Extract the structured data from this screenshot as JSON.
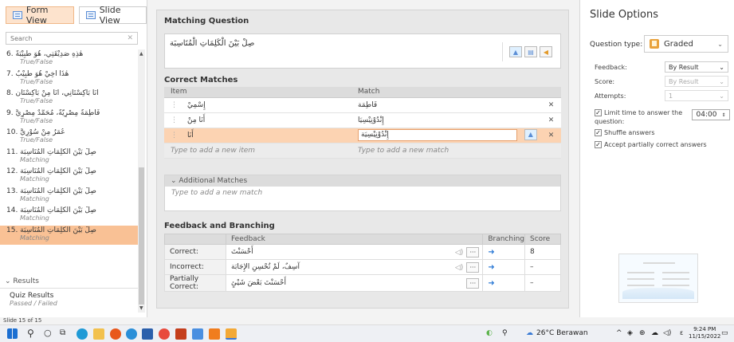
{
  "left_panel": {
    "form_view_label": "Form View",
    "slide_view_label": "Slide View",
    "search_placeholder": "Search",
    "slides": [
      {
        "title": "هٰذِهِ صَدِيْقَتِي، هُوَ طَبِيْبَةٌ .6",
        "subtitle": "True/False"
      },
      {
        "title": "هٰذَا أَخِيْ هُوَ طَبِيْبٌ .7",
        "subtitle": "True/False"
      },
      {
        "title": "أَنَا بَاكِسْتَانِي، أَنَا مِنْ بَاكِسْتَان .8",
        "subtitle": "True/False"
      },
      {
        "title": "فَاطِمَةٌ مِصْرِيَّةٌ، مُحَمَّدٌ مِصْرِيٌّ .9",
        "subtitle": "True/False"
      },
      {
        "title": "عُمَرُ مِنْ سُوْرِيَّ .10",
        "subtitle": "True/False"
      },
      {
        "title": "صِلْ بَيْنَ الْكَلِمَاتِ الْمُتَاسِبَة .11",
        "subtitle": "Matching"
      },
      {
        "title": "صِلْ بَيْنَ الْكَلِمَاتِ الْمُتَاسِبَة .12",
        "subtitle": "Matching"
      },
      {
        "title": "صِلْ بَيْنَ الْكَلِمَاتِ الْمُتَاسِبَة .13",
        "subtitle": "Matching"
      },
      {
        "title": "صِلْ بَيْنَ الْكَلِمَاتِ الْمُتَاسِبَة .14",
        "subtitle": "Matching"
      },
      {
        "title": "صِلْ بَيْنَ الْكَلِمَاتِ الْمُتَاسِبَة .15",
        "subtitle": "Matching"
      }
    ],
    "results_label": "Results",
    "quiz_results_title": "Quiz Results",
    "quiz_results_subtitle": "Passed / Failed"
  },
  "status": {
    "slide_counter": "Slide 15 of 15"
  },
  "matching": {
    "section_title": "Matching Question",
    "question_text": "صِلْ بَيْنَ الْكَلِمَاتِ الْمُتَاسِبَة",
    "correct_matches_title": "Correct Matches",
    "col_item": "Item",
    "col_match": "Match",
    "rows": [
      {
        "item": "إِسْمِيْ",
        "match": "فَاطِمَة"
      },
      {
        "item": "أَنَا مِنْ",
        "match": "إِنْدُوْنِيْسِيَا"
      },
      {
        "item": "أَنَا",
        "match": "إِنْدُوْنِيْسِيَة"
      }
    ],
    "add_item_placeholder": "Type to add a new item",
    "add_match_placeholder": "Type to add a new match",
    "additional_matches_label": "Additional Matches",
    "additional_match_placeholder": "Type to add a new match"
  },
  "feedback": {
    "section_title": "Feedback and Branching",
    "col_feedback": "Feedback",
    "col_branching": "Branching",
    "col_score": "Score",
    "rows": [
      {
        "label": "Correct:",
        "text": "أَحْسَنْتَ",
        "score": "8"
      },
      {
        "label": "Incorrect:",
        "text": "آسِفٌ، لَمْ تُحْسِنِ الإِجَابَة",
        "score": "–"
      },
      {
        "label": "Partially Correct:",
        "text": "أَحْسَنْتَ بَعْضَ شَيْئٍ",
        "score": "–"
      }
    ]
  },
  "options": {
    "title": "Slide Options",
    "question_type_label": "Question type:",
    "question_type_value": "Graded",
    "feedback_label": "Feedback:",
    "feedback_value": "By Result",
    "score_label": "Score:",
    "score_value": "By Result",
    "attempts_label": "Attempts:",
    "attempts_value": "1",
    "limit_time_label": "Limit time to answer the question:",
    "time_value": "04:00",
    "shuffle_label": "Shuffle answers",
    "accept_partial_label": "Accept partially correct answers"
  },
  "taskbar": {
    "weather": "26°C  Berawan",
    "time": "9:24 PM",
    "date": "11/15/2022"
  },
  "colors": {
    "selection": "#f9c195",
    "accent_blue": "#2e7bd6",
    "orange": "#e9a23b"
  }
}
